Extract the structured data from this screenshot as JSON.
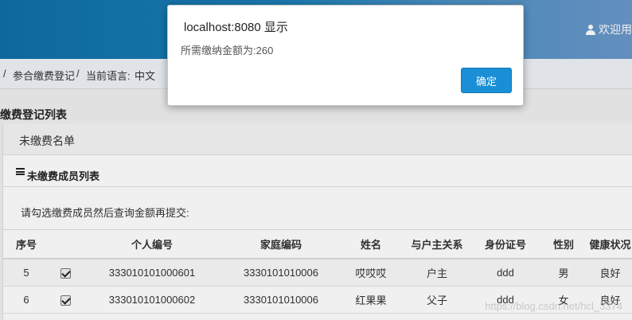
{
  "header": {
    "welcome": "欢迎用"
  },
  "breadcrumb": {
    "sep1": "/",
    "page": "参合缴费登记",
    "sep2": "/",
    "lang_label": "当前语言:",
    "lang_value": "中文"
  },
  "section": {
    "title": "缴费登记列表"
  },
  "panel": {
    "heading": "未缴费名单",
    "subheading": "未缴费成员列表",
    "hint": "请勾选缴费成员然后查询金额再提交:"
  },
  "table": {
    "headers": [
      "序号",
      "",
      "个人编号",
      "家庭编码",
      "姓名",
      "与户主关系",
      "身份证号",
      "性别",
      "健康状况"
    ],
    "rows": [
      {
        "index": "5",
        "checked": true,
        "person_id": "333010101000601",
        "family_id": "3330101010006",
        "name": "哎哎哎",
        "relation": "户主",
        "id_card": "ddd",
        "gender": "男",
        "health": "良好"
      },
      {
        "index": "6",
        "checked": true,
        "person_id": "333010101000602",
        "family_id": "3330101010006",
        "name": "红果果",
        "relation": "父子",
        "id_card": "ddd",
        "gender": "女",
        "health": "良好"
      }
    ]
  },
  "watermark": "https://blog.csdn.net/hcl_3374",
  "dialog": {
    "title": "localhost:8080 显示",
    "message": "所需缴纳金额为:260",
    "ok_label": "确定"
  },
  "colors": {
    "accent": "#1a8fd6",
    "language_value": "#c40000"
  }
}
